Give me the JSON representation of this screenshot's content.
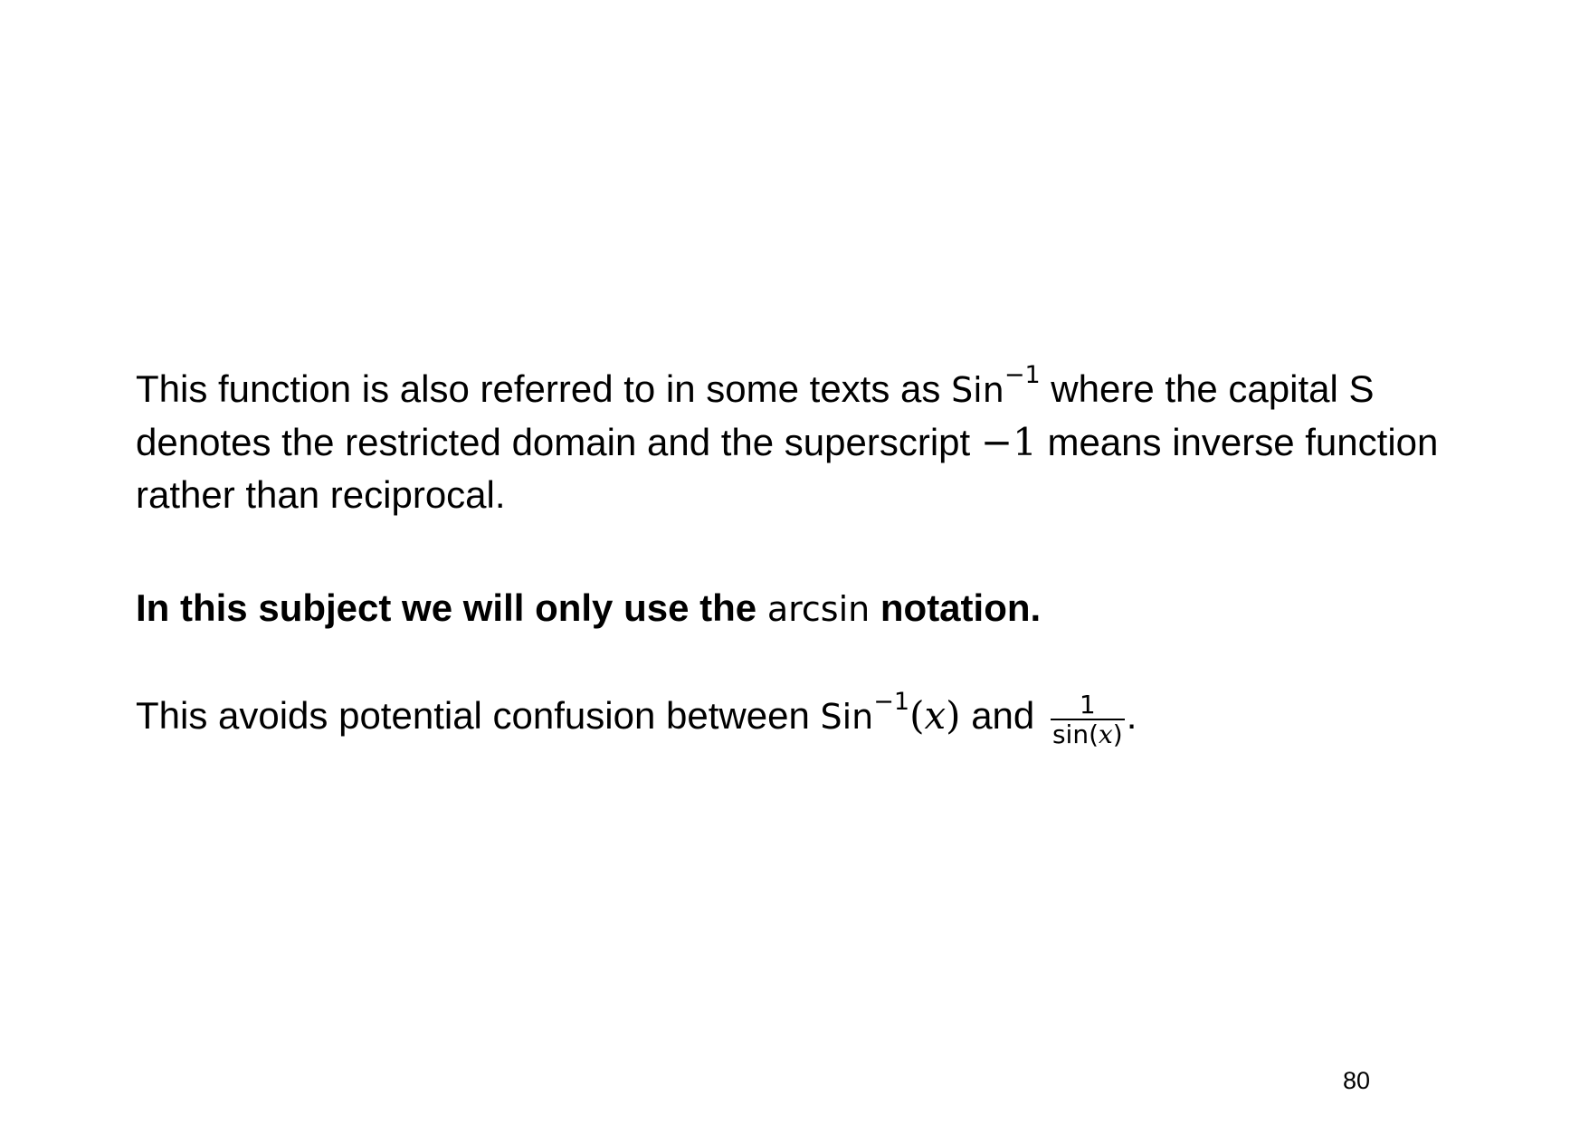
{
  "paragraph1": {
    "text_a": "This function is also referred to in some texts as ",
    "sin_cap": "Sin",
    "exponent": "−1",
    "text_b": " where the capital S denotes the restricted domain and the superscript ",
    "minus_one": "−1",
    "text_c": " means inverse function rather than reciprocal."
  },
  "paragraph2": {
    "text_a": "In this subject we will only use the ",
    "arcsin": "arcsin",
    "text_b": " notation."
  },
  "paragraph3": {
    "text_a": "This avoids potential confusion between ",
    "sin_cap": "Sin",
    "exponent": "−1",
    "paren_open": "(",
    "var_x": "x",
    "paren_close": ")",
    "text_b": " and ",
    "frac_numerator": "1",
    "frac_den_fn": "sin(",
    "frac_den_var": "x",
    "frac_den_close": ")",
    "text_c": "."
  },
  "page_number": "80"
}
